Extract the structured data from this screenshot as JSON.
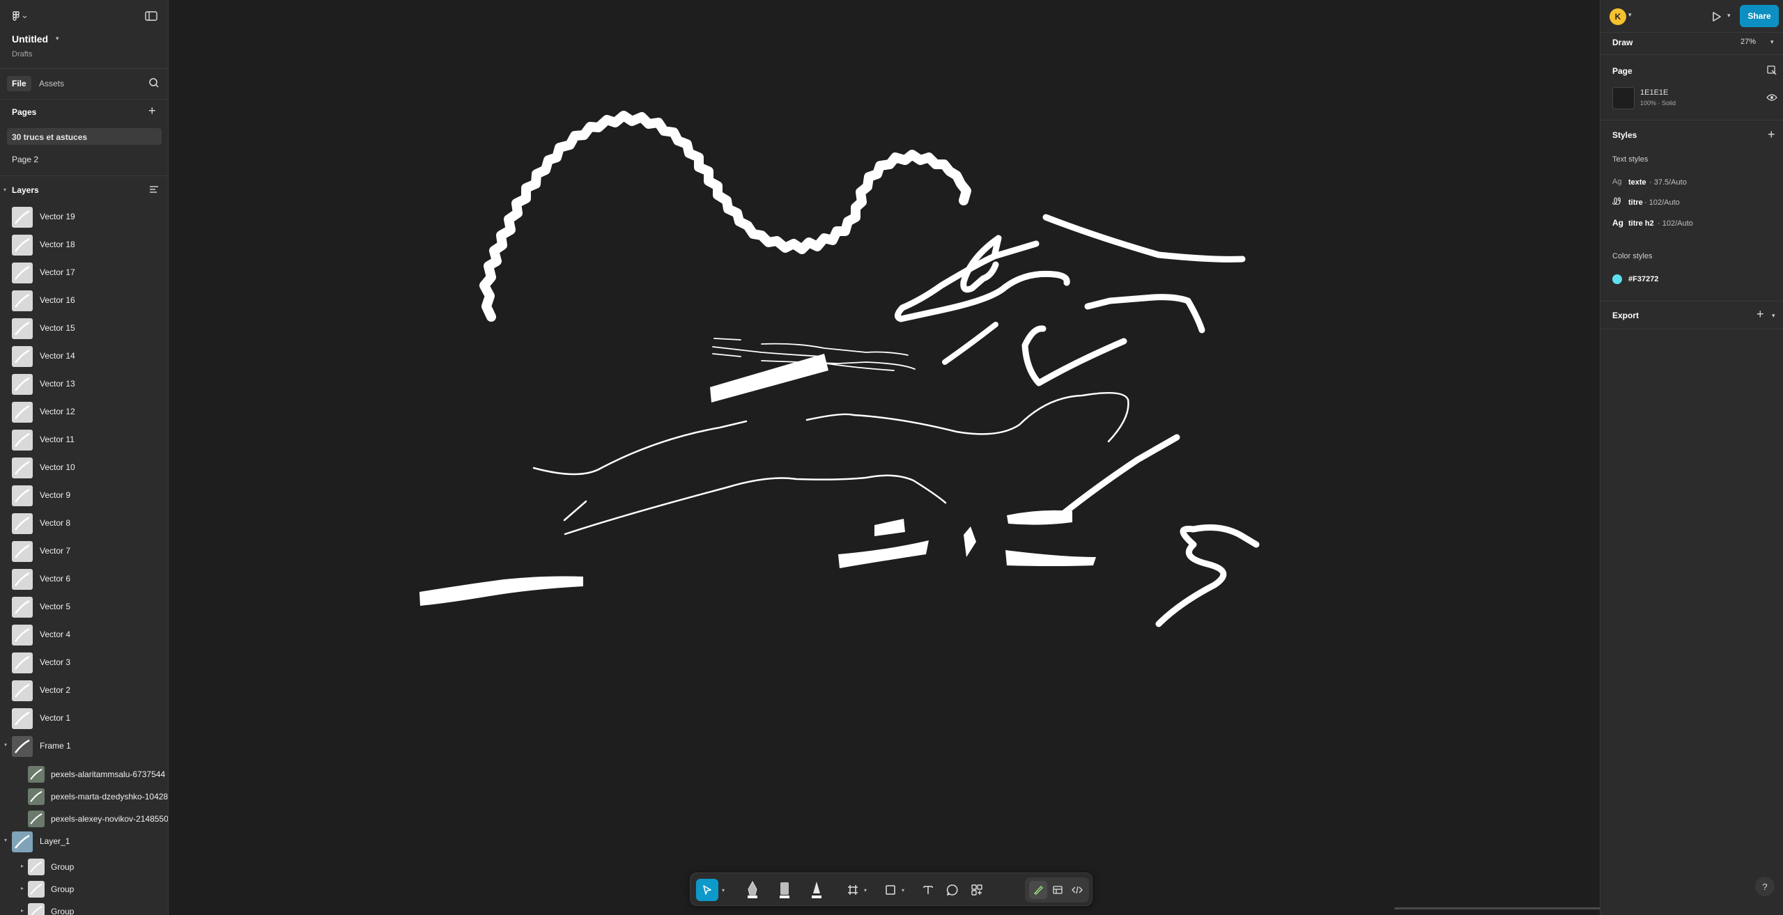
{
  "file": {
    "name": "Untitled",
    "location": "Drafts"
  },
  "left_tabs": {
    "file": "File",
    "assets": "Assets"
  },
  "pages": {
    "title": "Pages",
    "items": [
      {
        "label": "30 trucs et astuces",
        "active": true
      },
      {
        "label": "Page 2",
        "active": false
      }
    ]
  },
  "layers": {
    "title": "Layers",
    "items": [
      {
        "label": "Vector 19"
      },
      {
        "label": "Vector 18"
      },
      {
        "label": "Vector 17"
      },
      {
        "label": "Vector 16"
      },
      {
        "label": "Vector 15"
      },
      {
        "label": "Vector 14"
      },
      {
        "label": "Vector 13"
      },
      {
        "label": "Vector 12"
      },
      {
        "label": "Vector 11"
      },
      {
        "label": "Vector 10"
      },
      {
        "label": "Vector 9"
      },
      {
        "label": "Vector 8"
      },
      {
        "label": "Vector 7"
      },
      {
        "label": "Vector 6"
      },
      {
        "label": "Vector 5"
      },
      {
        "label": "Vector 4"
      },
      {
        "label": "Vector 3"
      },
      {
        "label": "Vector 2"
      },
      {
        "label": "Vector 1"
      },
      {
        "label": "Frame 1"
      },
      {
        "label": "pexels-alaritammsalu-6737544"
      },
      {
        "label": "pexels-marta-dzedyshko-10428"
      },
      {
        "label": "pexels-alexey-novikov-2148550"
      },
      {
        "label": "Layer_1"
      },
      {
        "label": "Group"
      },
      {
        "label": "Group"
      },
      {
        "label": "Group"
      }
    ]
  },
  "right": {
    "avatar_initial": "K",
    "share_label": "Share",
    "mode_label": "Draw",
    "zoom": "27%",
    "page_section": "Page",
    "page_color": "1E1E1E",
    "page_fill_detail": "100% · Solid",
    "styles_title": "Styles",
    "text_styles_title": "Text styles",
    "text_styles": [
      {
        "name": "texte",
        "detail": " · 37.5/Auto"
      },
      {
        "name": "titre",
        "detail": " · 102/Auto"
      },
      {
        "name": "titre h2",
        "detail": " · 102/Auto"
      }
    ],
    "color_styles_title": "Color styles",
    "color_style": {
      "name": "#F37272",
      "swatch": "#5fe0f0"
    },
    "export_title": "Export"
  },
  "colors": {
    "accent": "#0d99c9",
    "canvas": "#1e1e1e",
    "panel": "#2c2c2c",
    "avatar": "#f5c12e"
  },
  "icons": [
    "figma-menu-icon",
    "sidebar-toggle-icon",
    "search-icon",
    "plus-icon",
    "layers-list-icon",
    "play-icon",
    "move-tool-icon",
    "pen-tool-icon",
    "marker-tool-icon",
    "pencil-tool-icon",
    "frame-tool-icon",
    "rectangle-tool-icon",
    "text-tool-icon",
    "comment-tool-icon",
    "components-icon",
    "dev-mode-icon",
    "help-icon",
    "eye-icon"
  ]
}
